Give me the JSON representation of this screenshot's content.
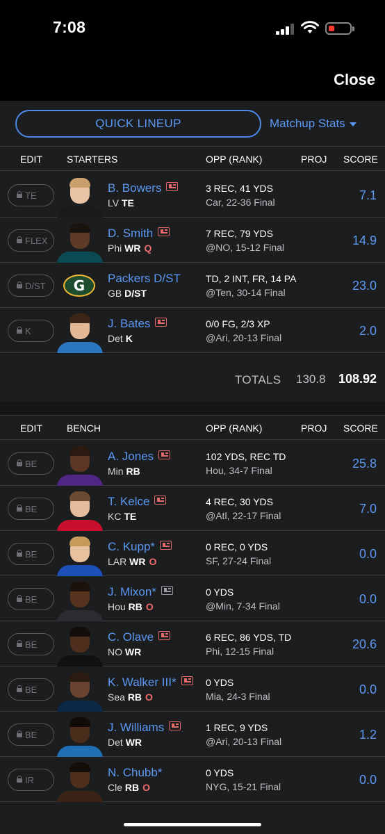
{
  "status_bar": {
    "time": "7:08"
  },
  "header": {
    "close_label": "Close"
  },
  "actions": {
    "quick_lineup": "QUICK LINEUP",
    "matchup_stats": "Matchup Stats"
  },
  "starters_header": {
    "edit": "EDIT",
    "section": "STARTERS",
    "opp": "OPP (RANK)",
    "proj": "PROJ",
    "score": "SCORE"
  },
  "starters": [
    {
      "slot": "TE",
      "name": "B. Bowers",
      "team": "LV",
      "pos": "TE",
      "status": "",
      "opp1": "3 REC, 41 YDS",
      "opp2": "Car, 22-36 Final",
      "score": "7.1",
      "news": "red"
    },
    {
      "slot": "FLEX",
      "name": "D. Smith",
      "team": "Phi",
      "pos": "WR",
      "status": "Q",
      "opp1": "7 REC, 79 YDS",
      "opp2": "@NO, 15-12 Final",
      "score": "14.9",
      "news": "red"
    },
    {
      "slot": "D/ST",
      "name": "Packers D/ST",
      "team": "GB",
      "pos": "D/ST",
      "status": "",
      "opp1": "TD, 2 INT, FR, 14 PA",
      "opp2": "@Ten, 30-14 Final",
      "score": "23.0",
      "news": "none",
      "logo": "G"
    },
    {
      "slot": "K",
      "name": "J. Bates",
      "team": "Det",
      "pos": "K",
      "status": "",
      "opp1": "0/0 FG, 2/3 XP",
      "opp2": "@Ari, 20-13 Final",
      "score": "2.0",
      "news": "red"
    }
  ],
  "totals": {
    "label": "TOTALS",
    "proj": "130.8",
    "score": "108.92"
  },
  "bench_header": {
    "edit": "EDIT",
    "section": "BENCH",
    "opp": "OPP (RANK)",
    "proj": "PROJ",
    "score": "SCORE"
  },
  "bench": [
    {
      "slot": "BE",
      "name": "A. Jones",
      "team": "Min",
      "pos": "RB",
      "status": "",
      "opp1": "102 YDS, REC TD",
      "opp2": "Hou, 34-7 Final",
      "score": "25.8",
      "news": "red"
    },
    {
      "slot": "BE",
      "name": "T. Kelce",
      "team": "KC",
      "pos": "TE",
      "status": "",
      "opp1": "4 REC, 30 YDS",
      "opp2": "@Atl, 22-17 Final",
      "score": "7.0",
      "news": "red"
    },
    {
      "slot": "BE",
      "name": "C. Kupp*",
      "team": "LAR",
      "pos": "WR",
      "status": "O",
      "opp1": "0 REC, 0 YDS",
      "opp2": "SF, 27-24 Final",
      "score": "0.0",
      "news": "red"
    },
    {
      "slot": "BE",
      "name": "J. Mixon*",
      "team": "Hou",
      "pos": "RB",
      "status": "O",
      "opp1": "0 YDS",
      "opp2": "@Min, 7-34 Final",
      "score": "0.0",
      "news": "grey"
    },
    {
      "slot": "BE",
      "name": "C. Olave",
      "team": "NO",
      "pos": "WR",
      "status": "",
      "opp1": "6 REC, 86 YDS, TD",
      "opp2": "Phi, 12-15 Final",
      "score": "20.6",
      "news": "red"
    },
    {
      "slot": "BE",
      "name": "K. Walker III*",
      "team": "Sea",
      "pos": "RB",
      "status": "O",
      "opp1": "0 YDS",
      "opp2": "Mia, 24-3 Final",
      "score": "0.0",
      "news": "red"
    },
    {
      "slot": "BE",
      "name": "J. Williams",
      "team": "Det",
      "pos": "WR",
      "status": "",
      "opp1": "1 REC, 9 YDS",
      "opp2": "@Ari, 20-13 Final",
      "score": "1.2",
      "news": "red"
    },
    {
      "slot": "IR",
      "name": "N. Chubb*",
      "team": "Cle",
      "pos": "RB",
      "status": "O",
      "opp1": "0 YDS",
      "opp2": "NYG, 15-21 Final",
      "score": "0.0",
      "news": "none"
    }
  ]
}
